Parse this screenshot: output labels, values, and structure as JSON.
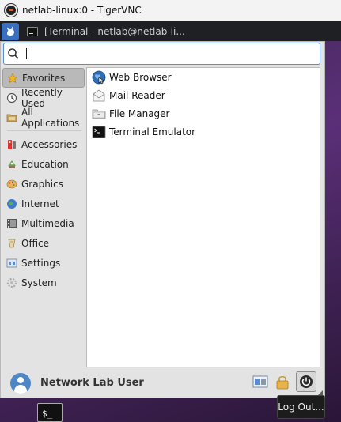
{
  "window": {
    "title": "netlab-linux:0 - TigerVNC"
  },
  "panel": {
    "task_label": "[Terminal - netlab@netlab-li..."
  },
  "search": {
    "value": "",
    "placeholder": ""
  },
  "categories": [
    {
      "label": "Favorites",
      "icon": "star-icon",
      "active": true
    },
    {
      "label": "Recently Used",
      "icon": "recent-icon"
    },
    {
      "label": "All Applications",
      "icon": "folder-icon"
    },
    {
      "label": "Accessories",
      "icon": "accessories-icon"
    },
    {
      "label": "Education",
      "icon": "education-icon"
    },
    {
      "label": "Graphics",
      "icon": "graphics-icon"
    },
    {
      "label": "Internet",
      "icon": "internet-icon"
    },
    {
      "label": "Multimedia",
      "icon": "multimedia-icon"
    },
    {
      "label": "Office",
      "icon": "office-icon"
    },
    {
      "label": "Settings",
      "icon": "settings-icon"
    },
    {
      "label": "System",
      "icon": "system-icon"
    }
  ],
  "apps": [
    {
      "label": "Web Browser",
      "icon": "web-browser-icon"
    },
    {
      "label": "Mail Reader",
      "icon": "mail-reader-icon"
    },
    {
      "label": "File Manager",
      "icon": "file-manager-icon"
    },
    {
      "label": "Terminal Emulator",
      "icon": "terminal-icon"
    }
  ],
  "footer": {
    "username": "Network Lab User"
  },
  "tooltip": {
    "text": "Log Out..."
  },
  "dock": {
    "terminal_glyph": "$_"
  },
  "colors": {
    "accent": "#5a8bd6",
    "panel": "#1f2024",
    "desktop": "#5b2f78"
  }
}
